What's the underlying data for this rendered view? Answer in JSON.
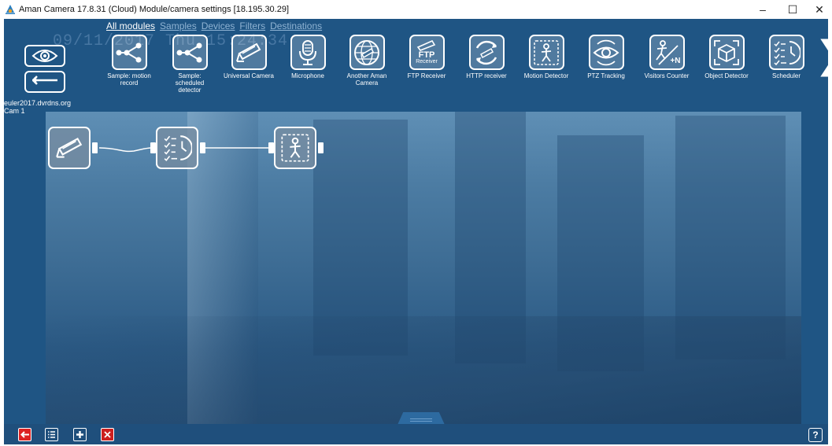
{
  "window": {
    "title": "Aman Camera 17.8.31 (Cloud) Module/camera settings [18.195.30.29]",
    "controls": {
      "minimize": "–",
      "maximize": "☐",
      "close": "✕"
    }
  },
  "overlay": {
    "timestamp": "09/11/2017 Thu 15:24:34"
  },
  "tabs": [
    {
      "label": "All modules",
      "active": true
    },
    {
      "label": "Samples",
      "active": false
    },
    {
      "label": "Devices",
      "active": false
    },
    {
      "label": "Filters",
      "active": false
    },
    {
      "label": "Destinations",
      "active": false
    }
  ],
  "camera": {
    "host": "euler2017.dvrdns.org",
    "name": "Cam  1"
  },
  "modules": [
    {
      "label": "Sample: motion record",
      "icon": "graph-node-icon"
    },
    {
      "label": "Sample: scheduled detector",
      "icon": "graph-node-icon"
    },
    {
      "label": "Universal Camera",
      "icon": "security-camera-icon"
    },
    {
      "label": "Microphone",
      "icon": "microphone-icon"
    },
    {
      "label": "Another Aman Camera",
      "icon": "globe-camera-icon"
    },
    {
      "label": "FTP Receiver",
      "icon": "ftp-receiver-icon",
      "badge_top": "FTP",
      "badge_bottom": "Receiver"
    },
    {
      "label": "HTTP receiver",
      "icon": "http-receiver-icon"
    },
    {
      "label": "Motion Detector",
      "icon": "motion-detector-icon"
    },
    {
      "label": "PTZ Tracking",
      "icon": "ptz-eye-icon"
    },
    {
      "label": "Visitors Counter",
      "icon": "visitors-counter-icon",
      "badge": "+N"
    },
    {
      "label": "Object Detector",
      "icon": "object-detector-icon"
    },
    {
      "label": "Scheduler",
      "icon": "scheduler-icon"
    }
  ],
  "flow_nodes": [
    {
      "name": "Universal Camera",
      "icon": "security-camera-icon"
    },
    {
      "name": "Scheduler",
      "icon": "scheduler-icon"
    },
    {
      "name": "Motion Detector",
      "icon": "motion-detector-icon"
    }
  ],
  "bottom_toolbar": {
    "help": "?"
  },
  "colors": {
    "app_bg": "#1f5584",
    "accent_red": "#d22222",
    "tab_inactive": "#8fb3d3"
  }
}
